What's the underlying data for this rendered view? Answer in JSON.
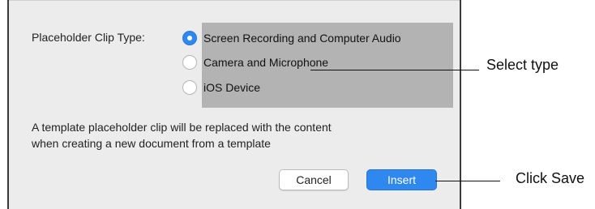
{
  "dialog": {
    "placeholder_label": "Placeholder Clip Type:",
    "options": [
      {
        "label": "Screen Recording and Computer Audio",
        "selected": true
      },
      {
        "label": "Camera and Microphone",
        "selected": false
      },
      {
        "label": "iOS Device",
        "selected": false
      }
    ],
    "description_line1": "A template placeholder clip will be replaced with the content",
    "description_line2": "when creating a new document from a template",
    "cancel_label": "Cancel",
    "insert_label": "Insert"
  },
  "annotations": {
    "select_type": "Select type",
    "click_save": "Click Save"
  },
  "colors": {
    "accent": "#2f87f0",
    "dialog_bg": "#ececec",
    "highlight": "#b3b3b3"
  }
}
